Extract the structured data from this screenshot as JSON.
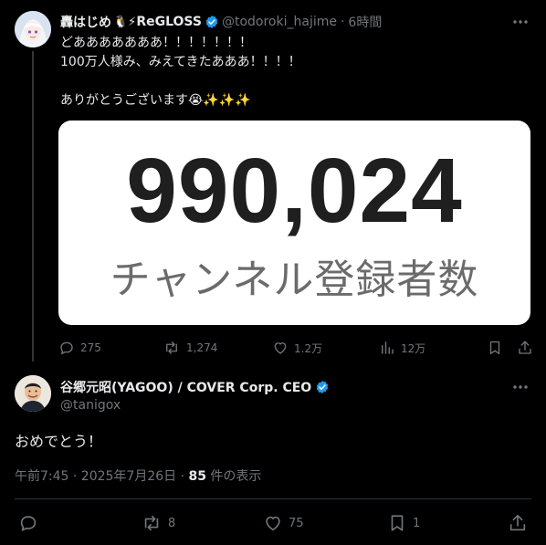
{
  "tweet1": {
    "display_name": "轟はじめ",
    "name_emoji": "🐧⚡",
    "name_suffix": "ReGLOSS",
    "handle": "@todoroki_hajime",
    "separator": "·",
    "time": "6時間",
    "text_lines": [
      "どあああああああ！！！！！！！",
      "100万人様み、みえてきたあああ！！！！",
      "",
      "ありがとうございます😭✨✨✨"
    ],
    "media": {
      "number": "990,024",
      "caption": "チャンネル登録者数"
    },
    "actions": {
      "replies": "275",
      "reposts": "1,274",
      "likes": "1.2万",
      "views": "12万"
    }
  },
  "tweet2": {
    "display_name": "谷郷元昭(YAGOO) / COVER Corp. CEO",
    "handle": "@tanigox",
    "text": "おめでとう！",
    "timestamp": "午前7:45 · 2025年7月26日 · ",
    "views_count": "85",
    "views_label": " 件の表示",
    "actions": {
      "reposts": "8",
      "likes": "75",
      "bookmarks": "1"
    }
  },
  "colors": {
    "background": "#000000",
    "text": "#e7e9ea",
    "muted": "#71767b",
    "verified": "#1d9bf0"
  }
}
